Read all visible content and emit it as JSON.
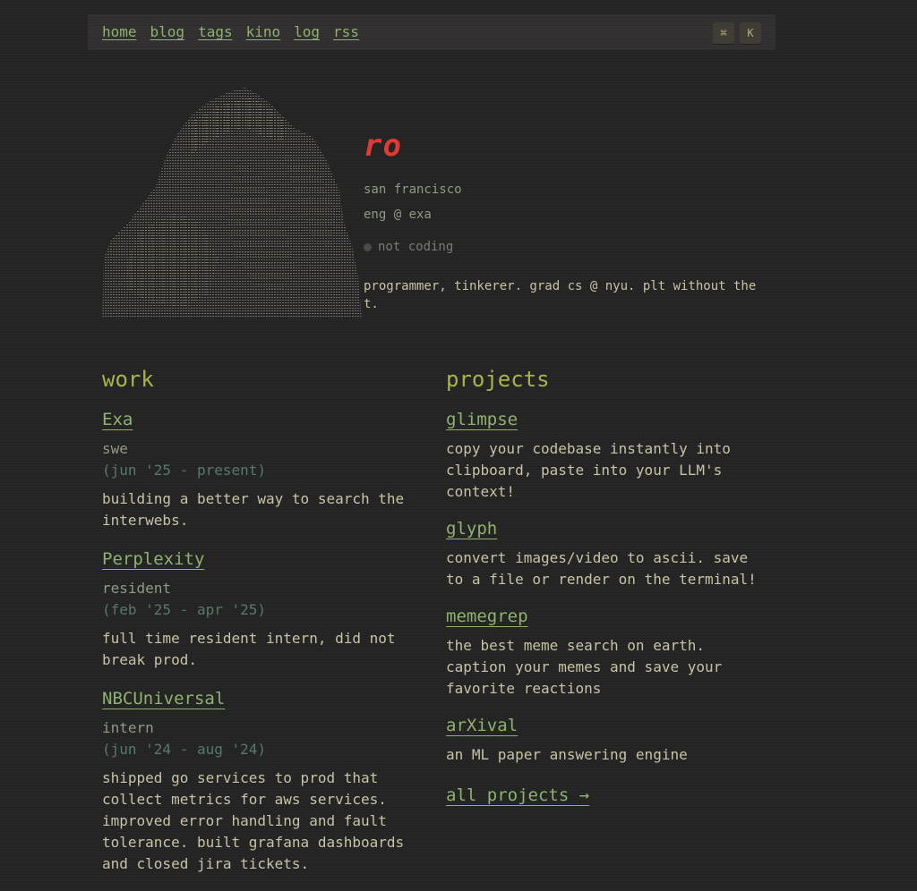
{
  "nav": {
    "links": [
      "home",
      "blog",
      "tags",
      "kino",
      "log",
      "rss"
    ],
    "shortcut_cmd": "⌘",
    "shortcut_key": "K"
  },
  "profile": {
    "name": "ro",
    "location": "san francisco",
    "role": "eng @ exa",
    "status": "not coding",
    "bio": "programmer, tinkerer. grad cs @ nyu. plt without the t."
  },
  "work": {
    "title": "work",
    "jobs": [
      {
        "company": "Exa",
        "role": "swe",
        "dates": "(jun '25 - present)",
        "desc": "building a better way to search the interwebs."
      },
      {
        "company": "Perplexity",
        "role": "resident",
        "dates": "(feb '25 - apr '25)",
        "desc": "full time resident intern, did not break prod."
      },
      {
        "company": "NBCUniversal",
        "role": "intern",
        "dates": "(jun '24 - aug '24)",
        "desc": "shipped go services to prod that collect metrics for aws services. improved error handling and fault tolerance. built grafana dashboards and closed jira tickets."
      }
    ]
  },
  "projects": {
    "title": "projects",
    "items": [
      {
        "name": "glimpse",
        "desc": "copy your codebase instantly into clipboard, paste into your LLM's context!"
      },
      {
        "name": "glyph",
        "desc": "convert images/video to ascii. save to a file or render on the terminal!"
      },
      {
        "name": "memegrep",
        "desc": "the best meme search on earth. caption your memes and save your favorite reactions"
      },
      {
        "name": "arXival",
        "desc": "an ML paper answering engine"
      }
    ],
    "all_link": "all projects →"
  },
  "colors": {
    "background": "#262626",
    "link": "#8fb26e",
    "accent_name": "#e03b33",
    "section_title": "#aab34a",
    "text": "#c8c3a6"
  }
}
